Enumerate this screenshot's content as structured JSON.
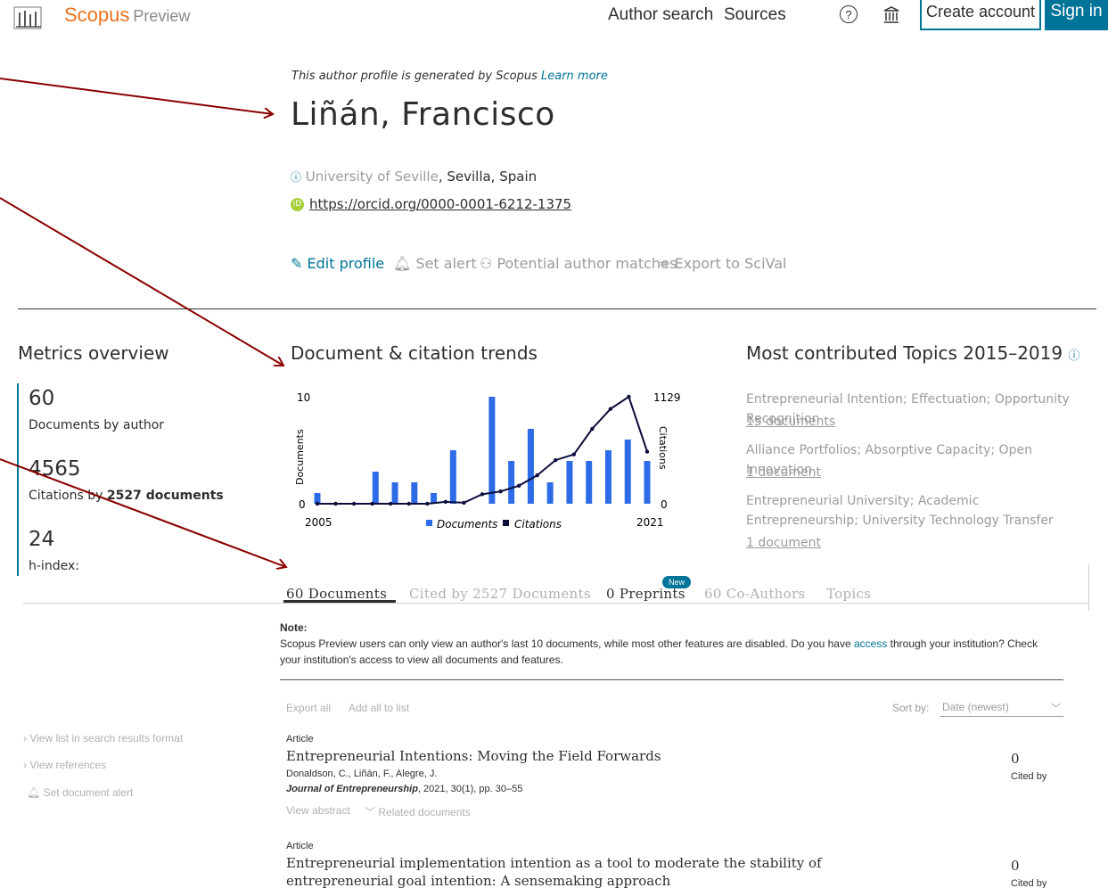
{
  "header": {
    "brand": "Scopus",
    "brand_sub": "Preview",
    "nav": [
      "Author search",
      "Sources"
    ],
    "help": "?",
    "create_account": "Create account",
    "sign_in": "Sign in"
  },
  "profile": {
    "notice": "This author profile is generated by Scopus",
    "learn_more": "Learn more",
    "name": "Liñán, Francisco",
    "affiliation": "University of Seville",
    "location": ", Sevilla, Spain",
    "orcid": "https://orcid.org/0000-0001-6212-1375",
    "actions": [
      "Edit profile",
      "Set alert",
      "Potential author matches",
      "Export to SciVal"
    ]
  },
  "metrics": {
    "title": "Metrics overview",
    "documents": "60",
    "documents_label": "Documents by author",
    "citations": "4565",
    "citations_label_pre": "Citations by ",
    "citations_label_bold": "2527 documents",
    "hindex": "24",
    "hindex_label": "h-index:"
  },
  "trends": {
    "title": "Document & citation trends"
  },
  "chart_data": {
    "type": "bar",
    "x": [
      2005,
      2006,
      2007,
      2008,
      2009,
      2010,
      2011,
      2012,
      2013,
      2014,
      2015,
      2016,
      2017,
      2018,
      2019,
      2020,
      2021
    ],
    "series": [
      {
        "name": "Documents",
        "values": [
          1,
          0,
          0,
          3,
          2,
          2,
          1,
          5,
          0,
          10,
          4,
          7,
          2,
          4,
          4,
          5,
          6,
          4
        ]
      },
      {
        "name": "Citations",
        "values": [
          0,
          0,
          0,
          0,
          0,
          0,
          0,
          20,
          10,
          100,
          130,
          190,
          300,
          460,
          520,
          790,
          1000,
          1129,
          550
        ]
      }
    ],
    "y_left_ticks": [
      "10",
      "0"
    ],
    "y_right_ticks": [
      "1129",
      "0"
    ],
    "x_ticks": [
      "2005",
      "2021"
    ],
    "ylabel": "Documents",
    "y2label": "Citations",
    "legend": [
      "Documents",
      "Citations"
    ],
    "ylim": [
      0,
      10
    ],
    "y2lim": [
      0,
      1129
    ],
    "colors": {
      "Documents": "#2e6be6",
      "Citations": "#0c0c3c"
    }
  },
  "topics": {
    "title": "Most contributed Topics 2015–2019",
    "items": [
      {
        "name": "Entrepreneurial Intention; Effectuation; Opportunity Recognition",
        "docs": "15 documents"
      },
      {
        "name": "Alliance Portfolios; Absorptive Capacity; Open Innovation",
        "docs": "1 document"
      },
      {
        "name": "Entrepreneurial University; Academic Entrepreneurship; University Technology Transfer",
        "docs": "1 document"
      }
    ]
  },
  "tabs": [
    "60 Documents",
    "Cited by 2527 Documents",
    "0 Preprints",
    "60 Co-Authors",
    "Topics"
  ],
  "new_badge": "New",
  "note": {
    "title": "Note:",
    "body_pre": "Scopus Preview users can only view an author's last 10 documents, while most other features are disabled. Do you have ",
    "access": "access",
    "body_post": " through your institution? Check your institution's access to view all documents and features."
  },
  "toolbar": {
    "export_all": "Export all",
    "add_to_list": "Add all to list",
    "sort_label": "Sort by:",
    "sort_value": "Date (newest)"
  },
  "side_links": [
    "View list in search results format",
    "View references",
    "Set document alert"
  ],
  "articles": [
    {
      "type": "Article",
      "title": "Entrepreneurial Intentions: Moving the Field Forwards",
      "authors": "Donaldson, C., Liñán, F., Alegre, J.",
      "journal": "Journal of Entrepreneurship",
      "details": ", 2021, 30(1), pp. 30–55",
      "view_abstract": "View abstract",
      "related": "Related documents",
      "cited": "0",
      "cited_label": "Cited by"
    },
    {
      "type": "Article",
      "title": "Entrepreneurial implementation intention as a tool to moderate the stability of entrepreneurial goal intention: A sensemaking approach",
      "cited": "0",
      "cited_label": "Cited by"
    }
  ],
  "colors": {
    "accent": "#007398",
    "brand": "#e9711c",
    "arrow": "#8b0000"
  }
}
